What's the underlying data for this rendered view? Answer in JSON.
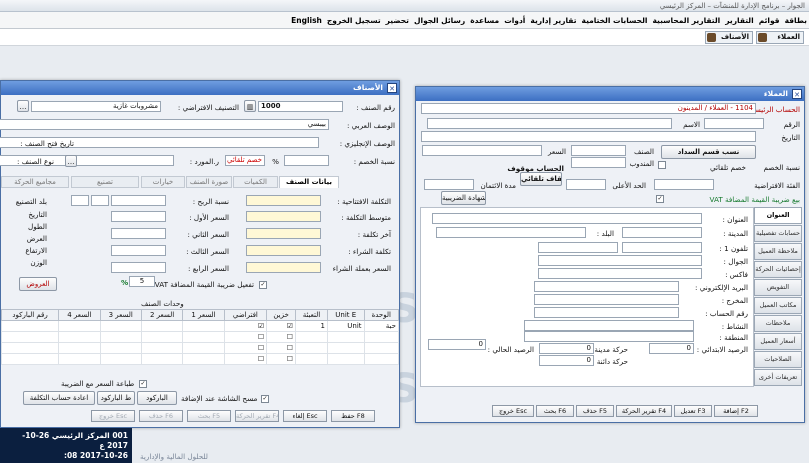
{
  "app": {
    "title": "الجوار – برنامج الإدارة للمنشآت – المركز الرئيسي"
  },
  "menu": [
    "بطاقة",
    "قوائم",
    "التقارير",
    "التقارير المحاسبية",
    "الحسابات الختامية",
    "تقارير إدارية",
    "أدوات",
    "مساعدة",
    "رسائل الجوال",
    "تحضير",
    "تسجيل الخروج",
    "English"
  ],
  "dock": {
    "items_label": "الأصناف",
    "customers_label": "العملاء"
  },
  "watermark": "SK",
  "items_window": {
    "title": "الأصناف",
    "code_label": "رقم الصنف :",
    "code_value": "1000",
    "default_class_label": "التصنيف الافتراضي :",
    "default_class_value": "مشروبات غازية",
    "arabic_desc_label": "الوصف العربي :",
    "arabic_desc_value": "بيبسي",
    "english_desc_label": "الوصف الإنجليزي :",
    "open_date_label": "تاريخ فتح الصنف :",
    "discount_label": "نسبة الخصم :",
    "percent": "%",
    "auto_discount": "خصم تلقائي",
    "supplier_label": "ر.المورد :",
    "item_type_label": "نوع الصنف :",
    "tabs": [
      "بيانات الصنف",
      "الكميات",
      "صورة الصنف",
      "خيارات",
      "تصنيع",
      "مجاميع الحركة"
    ],
    "cost_fields": [
      "التكلفة الافتتاحية :",
      "متوسط التكلفة :",
      "آخر تكلفة :",
      "تكلفة الشراء :",
      "السعر بعملة الشراء"
    ],
    "price_fields": [
      "نسبة الربح :",
      "السعر الأول :",
      "السعر الثاني :",
      "السعر الثالث :",
      "السعر الرابع :"
    ],
    "dims": [
      "بلد التصنيع",
      "التاريخ",
      "الطول",
      "العرض",
      "الارتفاع",
      "الوزن"
    ],
    "vat_check": "تفعيل ضريبة القيمة المضافة VAT",
    "vat_rate": "5",
    "offers_btn": "العروض",
    "units_title": "وحدات الصنف",
    "grid_headers": [
      "الوحدة",
      "Unit E",
      "التعبئة",
      "خزين",
      "افتراضي",
      "السعر 1",
      "السعر 2",
      "السعر 3",
      "السعر 4",
      "رقم الباركود"
    ],
    "grid_row": {
      "unit": "حبة",
      "unit_e": "Unit",
      "pack": "1"
    },
    "print_with_tax": "طباعة السعر مع الضريبة",
    "copy_on_add": "مسح الشاشة عند الإضافة",
    "barcode_btn": "الباركود",
    "print_barcode_btn": "ط الباركود",
    "recalc_btn": "اعادة حساب التكلفة",
    "fkeys": [
      "حفظ F8",
      "إلغاء Esc",
      "تقرير الحركة F4",
      "بحث F5",
      "حذف F6",
      "خروج Esc"
    ]
  },
  "customers_window": {
    "title": "العملاء",
    "main_account_label": "الحساب الرئيسي",
    "main_account_value": "1104 - العملاء / المدينون",
    "number_label": "الرقم",
    "name_label": "الاسم",
    "date_label": "التاريخ",
    "model_btn": "نسب قسم السداد",
    "class_label": "الصنف",
    "price_label": "السعر",
    "rep_label": "المندوب",
    "auto_disc": "خصم تلقائي",
    "cust_disc_label": "نسبة الخصم",
    "credit_limit_label": "الحد الأعلى",
    "credit_period_label": "مدة الائتمان",
    "stopped_label": "الحساب موقوف",
    "auto_stop": "إيقاف تلقائي",
    "default_cat_label": "الفئة الافتراضية",
    "tax_cert_btn": "الشهادة الضريبية",
    "vat_sales": "بيع ضريبة القيمة المضافة VAT",
    "side_tabs": [
      "العنوان",
      "حسابات تفصيلية",
      "ملاحظة العميل",
      "إحصائيات الحركة",
      "التفويض",
      "مكاتب العميل",
      "ملاحظات",
      "أسعار العميل",
      "الصلاحيات",
      "تعريفات أخرى"
    ],
    "addr_fields": [
      "العنوان :",
      "المدينة :",
      "البلد :",
      "تلفون 1 :",
      "الجوال :",
      "فاكس :",
      "البريد الإلكتروني :",
      "المخرج :",
      "رقم الحساب :",
      "النشاط :",
      "المنطقة :"
    ],
    "opening_balance_label": "الرصيد الابتدائي :",
    "current_balance_label": "الرصيد الحالي :",
    "debit_mov_label": "حركة مدينة :",
    "credit_mov_label": "حركة دائنة :",
    "zero": "0",
    "fkeys": [
      "إضافة F2",
      "تعديل F3",
      "تقرير الحركة F4",
      "حذف F5",
      "بحث F6",
      "خروج Esc"
    ]
  },
  "status": {
    "line1": "001 المركز الرئيسي 26-10-2017 ع",
    "line2": "2017-10-26 08:",
    "footer": "للحلول المالية والإدارية"
  }
}
